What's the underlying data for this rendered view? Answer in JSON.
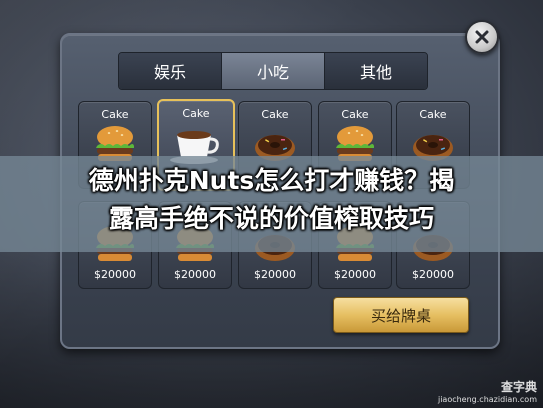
{
  "dialog": {
    "tabs": [
      {
        "label": "娱乐",
        "active": false
      },
      {
        "label": "小吃",
        "active": true
      },
      {
        "label": "其他",
        "active": false
      }
    ],
    "items": [
      {
        "label": "Cake",
        "price": "",
        "icon": "burger-icon",
        "selected": false
      },
      {
        "label": "Cake",
        "price": "",
        "icon": "coffee-cup-icon",
        "selected": true
      },
      {
        "label": "Cake",
        "price": "",
        "icon": "donut-icon",
        "selected": false
      },
      {
        "label": "Cake",
        "price": "",
        "icon": "burger-icon",
        "selected": false
      },
      {
        "label": "Cake",
        "price": "",
        "icon": "donut-icon",
        "selected": false
      },
      {
        "label": "",
        "price": "$20000",
        "icon": "burger-icon",
        "selected": false
      },
      {
        "label": "",
        "price": "$20000",
        "icon": "burger-icon",
        "selected": false
      },
      {
        "label": "",
        "price": "$20000",
        "icon": "donut-icon",
        "selected": false
      },
      {
        "label": "",
        "price": "$20000",
        "icon": "burger-icon",
        "selected": false
      },
      {
        "label": "",
        "price": "$20000",
        "icon": "donut-icon",
        "selected": false
      }
    ],
    "buy_button_label": "买给牌桌",
    "close_icon": "close-icon"
  },
  "overlay": {
    "title_line1": "德州扑克Nuts怎么打才赚钱？揭",
    "title_line2": "露高手绝不说的价值榨取技巧"
  },
  "watermark": {
    "main": "查字典",
    "sub": "jiaocheng.chazidian.com"
  },
  "colors": {
    "selected_border": "#e7c15a",
    "buy_button": "#e6bf62",
    "active_tab": "#7b8596"
  }
}
